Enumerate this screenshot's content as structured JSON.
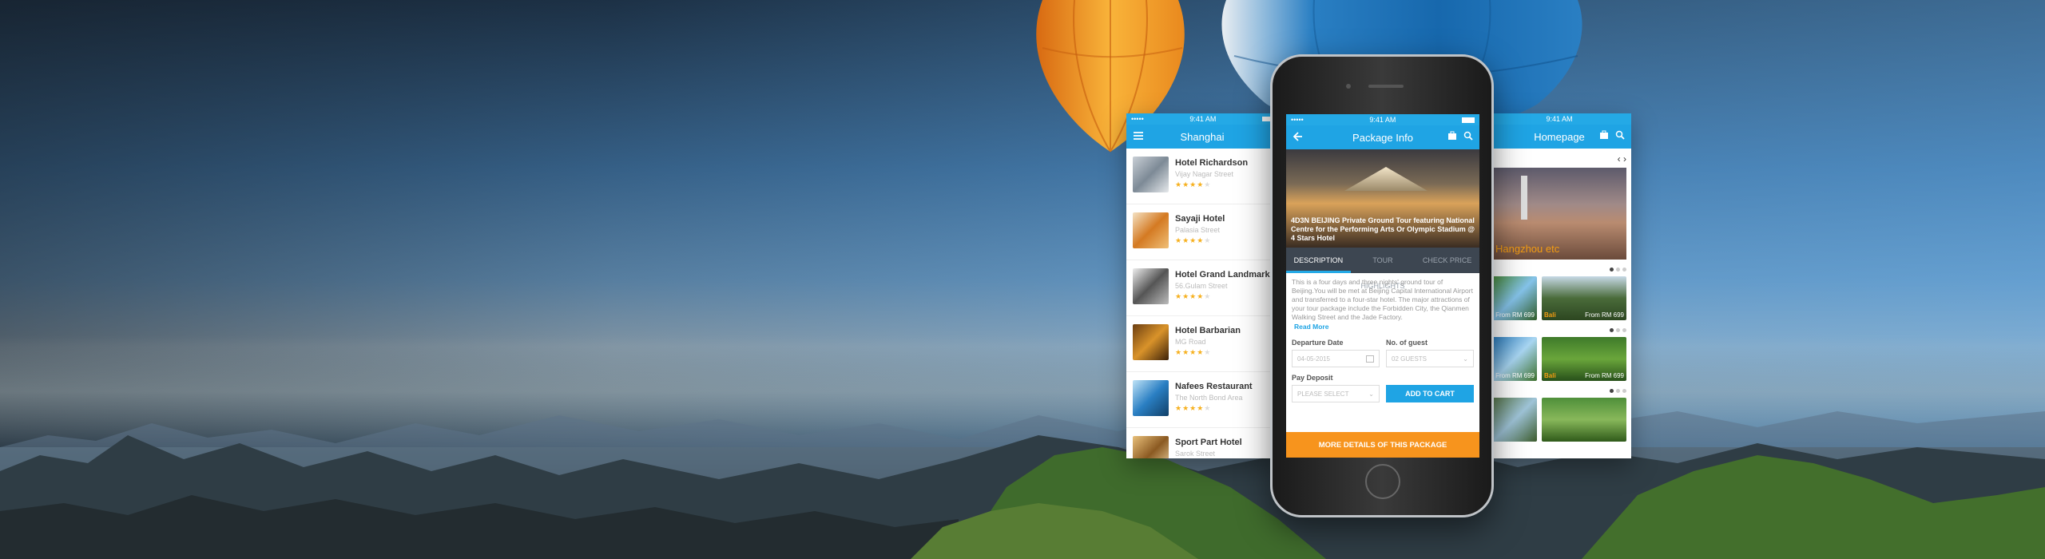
{
  "left_screen": {
    "status": {
      "carrier": "•••••",
      "time": "9:41 AM"
    },
    "title": "Shanghai",
    "items": [
      {
        "name": "Hotel Richardson",
        "address": "Vijay Nagar Street",
        "stars": 4
      },
      {
        "name": "Sayaji Hotel",
        "address": "Palasia Street",
        "stars": 4
      },
      {
        "name": "Hotel Grand Landmark",
        "address": "56.Gulam Street",
        "stars": 4
      },
      {
        "name": "Hotel Barbarian",
        "address": "MG Road",
        "stars": 4
      },
      {
        "name": "Nafees Restaurant",
        "address": "The North Bond Area",
        "stars": 4
      },
      {
        "name": "Sport Part Hotel",
        "address": "Sarok Street",
        "stars": 4
      }
    ]
  },
  "center_screen": {
    "status": {
      "carrier": "•••••",
      "time": "9:41 AM"
    },
    "title": "Package Info",
    "hero_caption": "4D3N BEIJING Private Ground Tour featuring National Centre for the Performing Arts Or Olympic Stadium @ 4 Stars Hotel",
    "tabs": [
      "DESCRIPTION",
      "TOUR HIGHLIGHTS",
      "CHECK PRICE"
    ],
    "description": "This is a four days and three nights' ground tour of Beijing.You will be met at Beijing Capital International Airport and transferred to a four-star hotel. The major attractions of your tour package include the Forbidden City, the Qianmen Walking Street and the Jade Factory.",
    "read_more": "Read More",
    "departure_label": "Departure Date",
    "departure_value": "04-05-2015",
    "guests_label": "No. of guest",
    "guests_value": "02 GUESTS",
    "pay_label": "Pay Deposit",
    "pay_placeholder": "PLEASE SELECT",
    "add_to_cart": "ADD TO CART",
    "more_details": "MORE DETAILS OF THIS PACKAGE"
  },
  "right_screen": {
    "status": {
      "time": "9:41 AM"
    },
    "title": "Homepage",
    "banner_caption": "Hangzhou etc",
    "rows": [
      [
        {
          "loc": "",
          "price": "From RM 699"
        },
        {
          "loc": "Bali",
          "price": "From RM 699"
        }
      ],
      [
        {
          "loc": "",
          "price": "From RM 699"
        },
        {
          "loc": "Bali",
          "price": "From RM 699"
        }
      ],
      [
        {
          "loc": "",
          "price": ""
        },
        {
          "loc": "",
          "price": ""
        }
      ]
    ]
  },
  "colors": {
    "accent": "#1fa4e4",
    "orange": "#f7941d",
    "dark": "#3d4651"
  }
}
